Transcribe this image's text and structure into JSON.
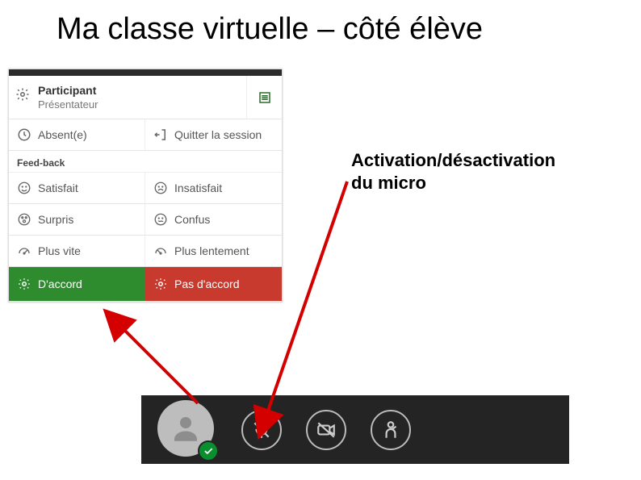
{
  "title": "Ma classe virtuelle – côté élève",
  "annotation": {
    "line1": "Activation/désactivation",
    "line2": "du micro"
  },
  "panel": {
    "participant_label": "Participant",
    "presenter_label": "Présentateur",
    "absent_label": "Absent(e)",
    "leave_label": "Quitter la session",
    "feedback_header": "Feed-back",
    "items": {
      "satisfied": "Satisfait",
      "unsatisfied": "Insatisfait",
      "surprised": "Surpris",
      "confused": "Confus",
      "faster": "Plus vite",
      "slower": "Plus lentement",
      "agree": "D'accord",
      "disagree": "Pas d'accord"
    }
  },
  "media_bar": {
    "avatar": "user-avatar",
    "status": "ok",
    "mic": "muted",
    "cam": "off",
    "hand": "lowered"
  }
}
